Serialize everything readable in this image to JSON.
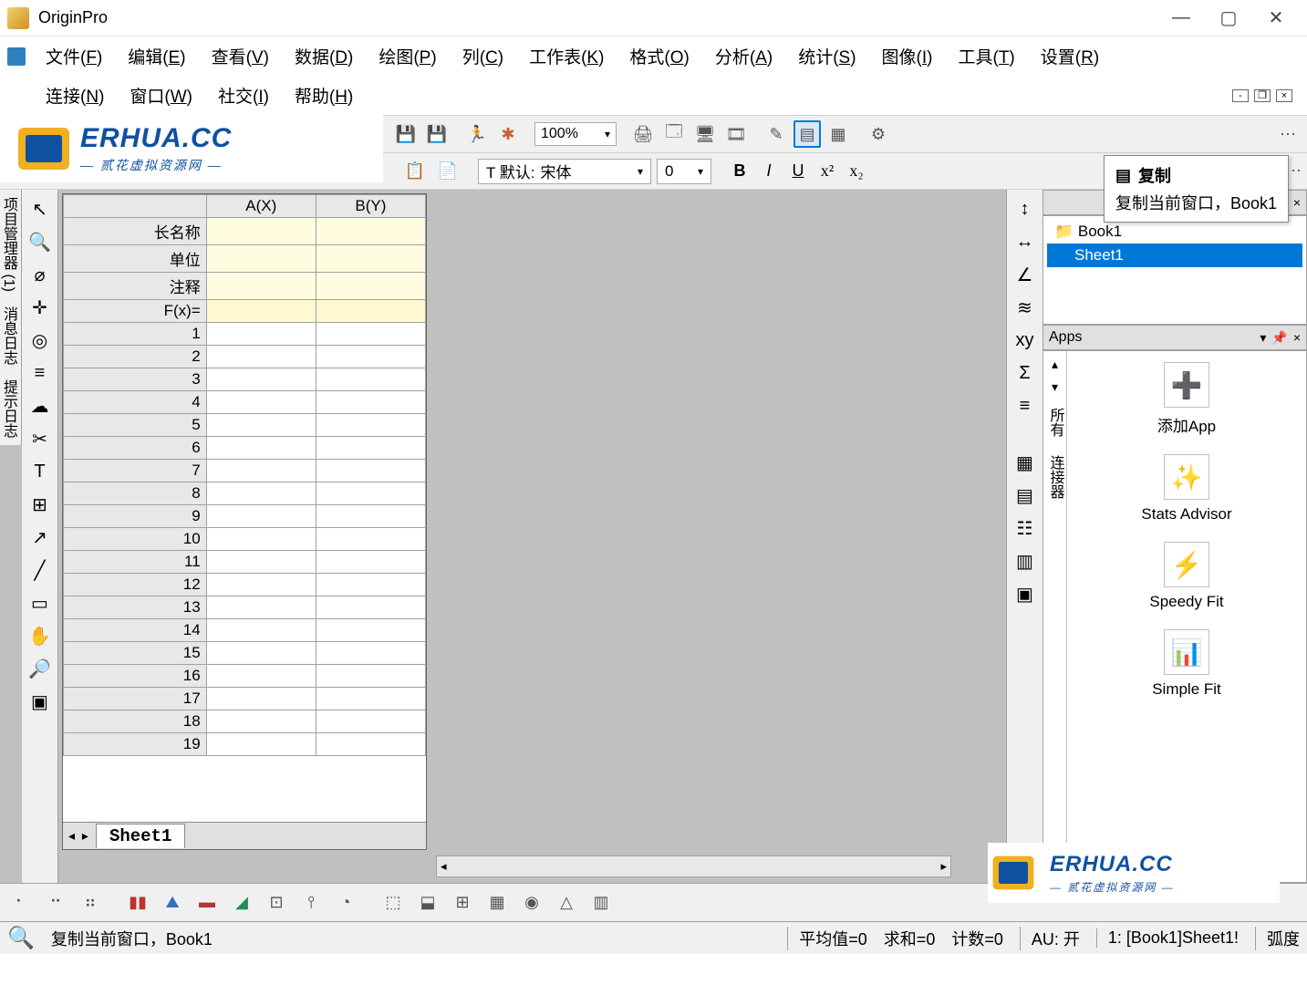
{
  "app_title": "OriginPro",
  "logo": {
    "brand": "ERHUA.CC",
    "sub": "— 贰花虚拟资源网 —"
  },
  "menu": {
    "row1": [
      "文件(F)",
      "编辑(E)",
      "查看(V)",
      "数据(D)",
      "绘图(P)",
      "列(C)",
      "工作表(K)",
      "格式(O)",
      "分析(A)",
      "统计(S)",
      "图像(I)",
      "工具(T)",
      "设置(R)"
    ],
    "row2": [
      "连接(N)",
      "窗口(W)",
      "社交(I)",
      "帮助(H)"
    ]
  },
  "toolbar": {
    "zoom": "100%",
    "font_prefix": "T 默认:",
    "font_name": "宋体",
    "font_size": "0"
  },
  "tooltip": {
    "title": "复制",
    "desc": "复制当前窗口，Book1"
  },
  "side_tabs": [
    "项目管理器 (1)",
    "消息日志",
    "提示日志"
  ],
  "sheet": {
    "columns": [
      "A(X)",
      "B(Y)"
    ],
    "header_rows": [
      "长名称",
      "单位",
      "注释",
      "F(x)="
    ],
    "row_count": 19,
    "tab": "Sheet1"
  },
  "project_tree": {
    "book": "Book1",
    "sheet": "Sheet1"
  },
  "apps": {
    "panel_title": "Apps",
    "side_labels": [
      "所有",
      "连接器"
    ],
    "items": [
      "添加App",
      "Stats Advisor",
      "Speedy Fit",
      "Simple Fit"
    ]
  },
  "status": {
    "msg": "复制当前窗口，Book1",
    "avg": "平均值=0",
    "sum": "求和=0",
    "count": "计数=0",
    "au": "AU: 开",
    "ref": "1: [Book1]Sheet1!",
    "mode": "弧度"
  }
}
